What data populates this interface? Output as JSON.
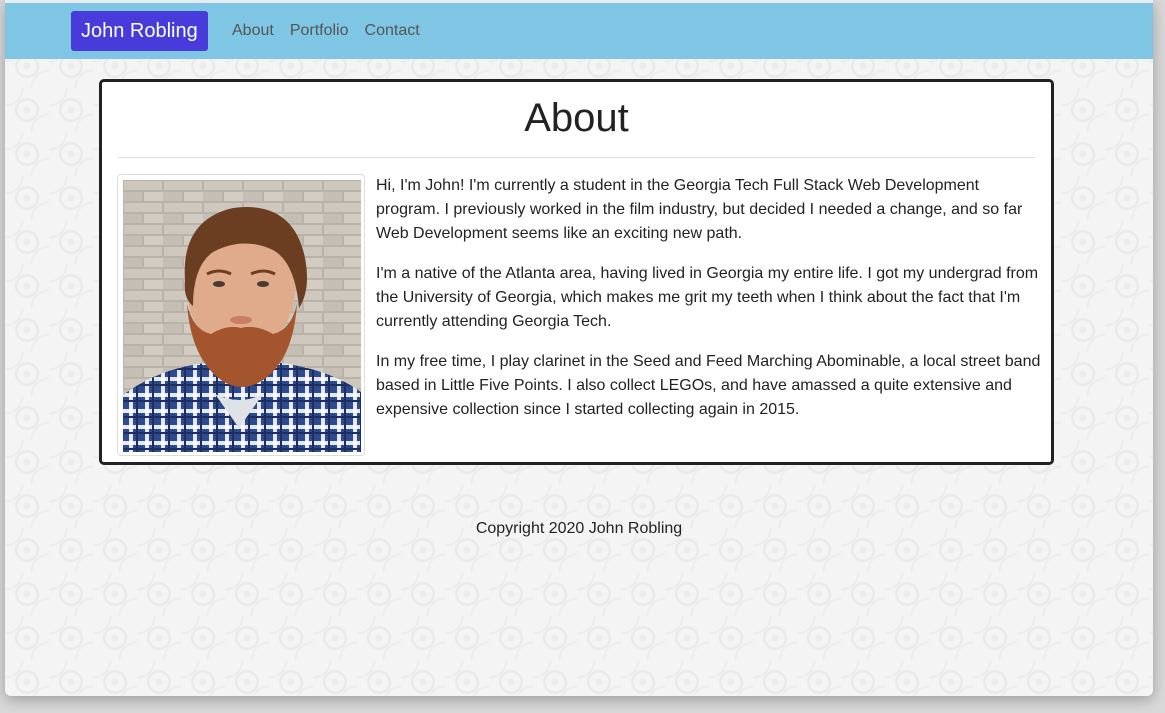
{
  "navbar": {
    "brand": "John Robling",
    "links": [
      "About",
      "Portfolio",
      "Contact"
    ]
  },
  "about": {
    "title": "About",
    "paragraphs": [
      "Hi, I'm John! I'm currently a student in the Georgia Tech Full Stack Web Development program. I previously worked in the film industry, but decided I needed a change, and so far Web Development seems like an exciting new path.",
      "I'm a native of the Atlanta area, having lived in Georgia my entire life. I got my undergrad from the University of Georgia, which makes me grit my teeth when I think about the fact that I'm currently attending Georgia Tech.",
      "In my free time, I play clarinet in the Seed and Feed Marching Abominable, a local street band based in Little Five Points. I also collect LEGOs, and have amassed a quite extensive and expensive collection since I started collecting again in 2015."
    ]
  },
  "footer": {
    "copyright": "Copyright 2020 John Robling"
  },
  "colors": {
    "navbar_bg": "#7fc6e5",
    "brand_bg": "#473bd9",
    "card_border": "#222222"
  }
}
